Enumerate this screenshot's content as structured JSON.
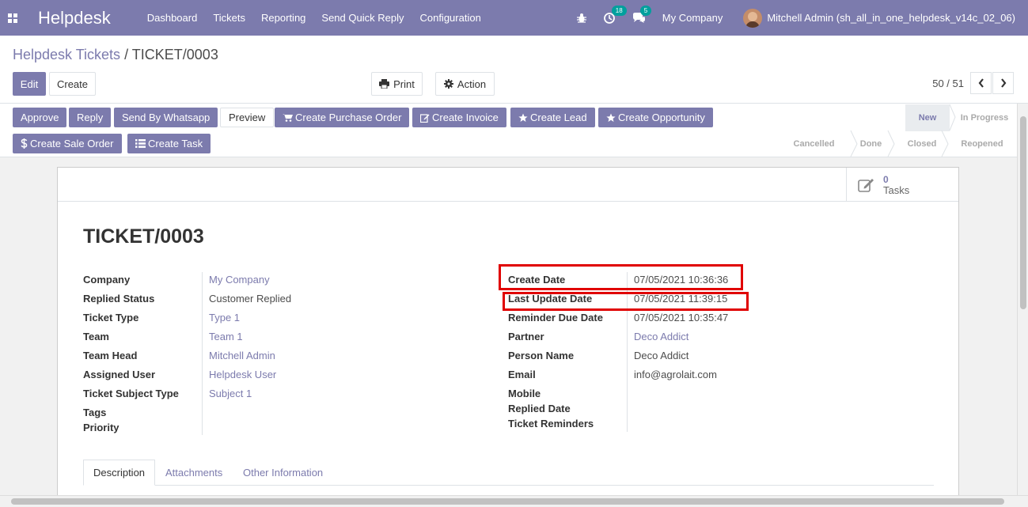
{
  "app": {
    "brand": "Helpdesk"
  },
  "nav": {
    "menu": [
      "Dashboard",
      "Tickets",
      "Reporting",
      "Send Quick Reply",
      "Configuration"
    ],
    "activity_count": "18",
    "message_count": "5",
    "company": "My Company",
    "user": "Mitchell Admin (sh_all_in_one_helpdesk_v14c_02_06)"
  },
  "breadcrumb": {
    "parent": "Helpdesk Tickets",
    "separator": "/",
    "current": "TICKET/0003"
  },
  "toolbar": {
    "edit": "Edit",
    "create": "Create",
    "print": "Print",
    "action": "Action"
  },
  "pager": {
    "text": "50 / 51"
  },
  "header_buttons": {
    "approve": "Approve",
    "reply": "Reply",
    "send_whatsapp": "Send By Whatsapp",
    "preview": "Preview",
    "create_po": "Create Purchase Order",
    "create_invoice": "Create Invoice",
    "create_lead": "Create Lead",
    "create_opportunity": "Create Opportunity",
    "create_sale_order": "Create Sale Order",
    "create_task": "Create Task"
  },
  "stages": {
    "new": "New",
    "in_progress": "In Progress",
    "cancelled": "Cancelled",
    "done": "Done",
    "closed": "Closed",
    "reopened": "Reopened"
  },
  "smart_button": {
    "count": "0",
    "label": "Tasks"
  },
  "ticket": {
    "title": "TICKET/0003"
  },
  "left_fields": {
    "company": {
      "label": "Company",
      "value": "My Company"
    },
    "replied_status": {
      "label": "Replied Status",
      "value": "Customer Replied"
    },
    "ticket_type": {
      "label": "Ticket Type",
      "value": "Type 1"
    },
    "team": {
      "label": "Team",
      "value": "Team 1"
    },
    "team_head": {
      "label": "Team Head",
      "value": "Mitchell Admin"
    },
    "assigned_user": {
      "label": "Assigned User",
      "value": "Helpdesk User"
    },
    "subject_type": {
      "label": "Ticket Subject Type",
      "value": "Subject 1"
    },
    "tags": {
      "label": "Tags"
    },
    "priority": {
      "label": "Priority"
    }
  },
  "right_fields": {
    "create_date": {
      "label": "Create Date",
      "value": "07/05/2021 10:36:36"
    },
    "last_update": {
      "label": "Last Update Date",
      "value": "07/05/2021 11:39:15"
    },
    "reminder_due": {
      "label": "Reminder Due Date",
      "value": "07/05/2021 10:35:47"
    },
    "partner": {
      "label": "Partner",
      "value": "Deco Addict"
    },
    "person_name": {
      "label": "Person Name",
      "value": "Deco Addict"
    },
    "email": {
      "label": "Email",
      "value": "info@agrolait.com"
    },
    "mobile": {
      "label": "Mobile"
    },
    "replied_date": {
      "label": "Replied Date"
    },
    "ticket_reminders": {
      "label": "Ticket Reminders"
    }
  },
  "tabs": [
    "Description",
    "Attachments",
    "Other Information"
  ],
  "colors": {
    "primary": "#7c7bad",
    "highlight": "#e00000",
    "badge": "#00a09d"
  }
}
